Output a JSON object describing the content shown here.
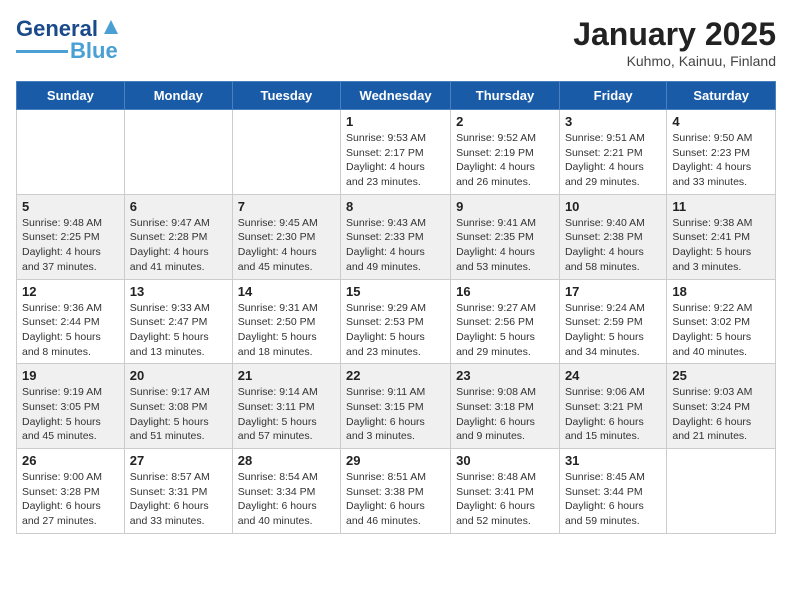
{
  "header": {
    "logo_general": "General",
    "logo_blue": "Blue",
    "month": "January 2025",
    "location": "Kuhmo, Kainuu, Finland"
  },
  "weekdays": [
    "Sunday",
    "Monday",
    "Tuesday",
    "Wednesday",
    "Thursday",
    "Friday",
    "Saturday"
  ],
  "weeks": [
    [
      {
        "day": "",
        "info": ""
      },
      {
        "day": "",
        "info": ""
      },
      {
        "day": "",
        "info": ""
      },
      {
        "day": "1",
        "info": "Sunrise: 9:53 AM\nSunset: 2:17 PM\nDaylight: 4 hours\nand 23 minutes."
      },
      {
        "day": "2",
        "info": "Sunrise: 9:52 AM\nSunset: 2:19 PM\nDaylight: 4 hours\nand 26 minutes."
      },
      {
        "day": "3",
        "info": "Sunrise: 9:51 AM\nSunset: 2:21 PM\nDaylight: 4 hours\nand 29 minutes."
      },
      {
        "day": "4",
        "info": "Sunrise: 9:50 AM\nSunset: 2:23 PM\nDaylight: 4 hours\nand 33 minutes."
      }
    ],
    [
      {
        "day": "5",
        "info": "Sunrise: 9:48 AM\nSunset: 2:25 PM\nDaylight: 4 hours\nand 37 minutes."
      },
      {
        "day": "6",
        "info": "Sunrise: 9:47 AM\nSunset: 2:28 PM\nDaylight: 4 hours\nand 41 minutes."
      },
      {
        "day": "7",
        "info": "Sunrise: 9:45 AM\nSunset: 2:30 PM\nDaylight: 4 hours\nand 45 minutes."
      },
      {
        "day": "8",
        "info": "Sunrise: 9:43 AM\nSunset: 2:33 PM\nDaylight: 4 hours\nand 49 minutes."
      },
      {
        "day": "9",
        "info": "Sunrise: 9:41 AM\nSunset: 2:35 PM\nDaylight: 4 hours\nand 53 minutes."
      },
      {
        "day": "10",
        "info": "Sunrise: 9:40 AM\nSunset: 2:38 PM\nDaylight: 4 hours\nand 58 minutes."
      },
      {
        "day": "11",
        "info": "Sunrise: 9:38 AM\nSunset: 2:41 PM\nDaylight: 5 hours\nand 3 minutes."
      }
    ],
    [
      {
        "day": "12",
        "info": "Sunrise: 9:36 AM\nSunset: 2:44 PM\nDaylight: 5 hours\nand 8 minutes."
      },
      {
        "day": "13",
        "info": "Sunrise: 9:33 AM\nSunset: 2:47 PM\nDaylight: 5 hours\nand 13 minutes."
      },
      {
        "day": "14",
        "info": "Sunrise: 9:31 AM\nSunset: 2:50 PM\nDaylight: 5 hours\nand 18 minutes."
      },
      {
        "day": "15",
        "info": "Sunrise: 9:29 AM\nSunset: 2:53 PM\nDaylight: 5 hours\nand 23 minutes."
      },
      {
        "day": "16",
        "info": "Sunrise: 9:27 AM\nSunset: 2:56 PM\nDaylight: 5 hours\nand 29 minutes."
      },
      {
        "day": "17",
        "info": "Sunrise: 9:24 AM\nSunset: 2:59 PM\nDaylight: 5 hours\nand 34 minutes."
      },
      {
        "day": "18",
        "info": "Sunrise: 9:22 AM\nSunset: 3:02 PM\nDaylight: 5 hours\nand 40 minutes."
      }
    ],
    [
      {
        "day": "19",
        "info": "Sunrise: 9:19 AM\nSunset: 3:05 PM\nDaylight: 5 hours\nand 45 minutes."
      },
      {
        "day": "20",
        "info": "Sunrise: 9:17 AM\nSunset: 3:08 PM\nDaylight: 5 hours\nand 51 minutes."
      },
      {
        "day": "21",
        "info": "Sunrise: 9:14 AM\nSunset: 3:11 PM\nDaylight: 5 hours\nand 57 minutes."
      },
      {
        "day": "22",
        "info": "Sunrise: 9:11 AM\nSunset: 3:15 PM\nDaylight: 6 hours\nand 3 minutes."
      },
      {
        "day": "23",
        "info": "Sunrise: 9:08 AM\nSunset: 3:18 PM\nDaylight: 6 hours\nand 9 minutes."
      },
      {
        "day": "24",
        "info": "Sunrise: 9:06 AM\nSunset: 3:21 PM\nDaylight: 6 hours\nand 15 minutes."
      },
      {
        "day": "25",
        "info": "Sunrise: 9:03 AM\nSunset: 3:24 PM\nDaylight: 6 hours\nand 21 minutes."
      }
    ],
    [
      {
        "day": "26",
        "info": "Sunrise: 9:00 AM\nSunset: 3:28 PM\nDaylight: 6 hours\nand 27 minutes."
      },
      {
        "day": "27",
        "info": "Sunrise: 8:57 AM\nSunset: 3:31 PM\nDaylight: 6 hours\nand 33 minutes."
      },
      {
        "day": "28",
        "info": "Sunrise: 8:54 AM\nSunset: 3:34 PM\nDaylight: 6 hours\nand 40 minutes."
      },
      {
        "day": "29",
        "info": "Sunrise: 8:51 AM\nSunset: 3:38 PM\nDaylight: 6 hours\nand 46 minutes."
      },
      {
        "day": "30",
        "info": "Sunrise: 8:48 AM\nSunset: 3:41 PM\nDaylight: 6 hours\nand 52 minutes."
      },
      {
        "day": "31",
        "info": "Sunrise: 8:45 AM\nSunset: 3:44 PM\nDaylight: 6 hours\nand 59 minutes."
      },
      {
        "day": "",
        "info": ""
      }
    ]
  ]
}
